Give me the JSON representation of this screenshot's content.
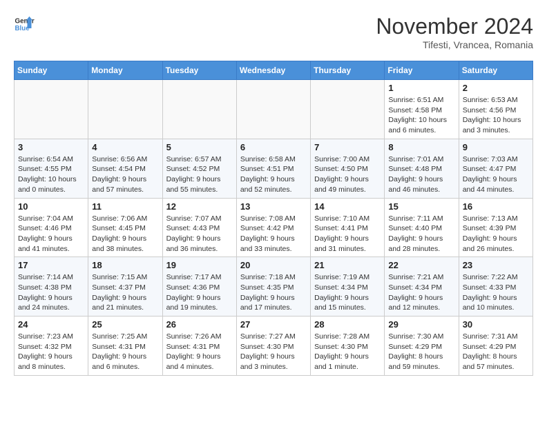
{
  "header": {
    "logo_line1": "General",
    "logo_line2": "Blue",
    "month_title": "November 2024",
    "location": "Tifesti, Vrancea, Romania"
  },
  "weekdays": [
    "Sunday",
    "Monday",
    "Tuesday",
    "Wednesday",
    "Thursday",
    "Friday",
    "Saturday"
  ],
  "weeks": [
    [
      {
        "day": "",
        "info": ""
      },
      {
        "day": "",
        "info": ""
      },
      {
        "day": "",
        "info": ""
      },
      {
        "day": "",
        "info": ""
      },
      {
        "day": "",
        "info": ""
      },
      {
        "day": "1",
        "info": "Sunrise: 6:51 AM\nSunset: 4:58 PM\nDaylight: 10 hours and 6 minutes."
      },
      {
        "day": "2",
        "info": "Sunrise: 6:53 AM\nSunset: 4:56 PM\nDaylight: 10 hours and 3 minutes."
      }
    ],
    [
      {
        "day": "3",
        "info": "Sunrise: 6:54 AM\nSunset: 4:55 PM\nDaylight: 10 hours and 0 minutes."
      },
      {
        "day": "4",
        "info": "Sunrise: 6:56 AM\nSunset: 4:54 PM\nDaylight: 9 hours and 57 minutes."
      },
      {
        "day": "5",
        "info": "Sunrise: 6:57 AM\nSunset: 4:52 PM\nDaylight: 9 hours and 55 minutes."
      },
      {
        "day": "6",
        "info": "Sunrise: 6:58 AM\nSunset: 4:51 PM\nDaylight: 9 hours and 52 minutes."
      },
      {
        "day": "7",
        "info": "Sunrise: 7:00 AM\nSunset: 4:50 PM\nDaylight: 9 hours and 49 minutes."
      },
      {
        "day": "8",
        "info": "Sunrise: 7:01 AM\nSunset: 4:48 PM\nDaylight: 9 hours and 46 minutes."
      },
      {
        "day": "9",
        "info": "Sunrise: 7:03 AM\nSunset: 4:47 PM\nDaylight: 9 hours and 44 minutes."
      }
    ],
    [
      {
        "day": "10",
        "info": "Sunrise: 7:04 AM\nSunset: 4:46 PM\nDaylight: 9 hours and 41 minutes."
      },
      {
        "day": "11",
        "info": "Sunrise: 7:06 AM\nSunset: 4:45 PM\nDaylight: 9 hours and 38 minutes."
      },
      {
        "day": "12",
        "info": "Sunrise: 7:07 AM\nSunset: 4:43 PM\nDaylight: 9 hours and 36 minutes."
      },
      {
        "day": "13",
        "info": "Sunrise: 7:08 AM\nSunset: 4:42 PM\nDaylight: 9 hours and 33 minutes."
      },
      {
        "day": "14",
        "info": "Sunrise: 7:10 AM\nSunset: 4:41 PM\nDaylight: 9 hours and 31 minutes."
      },
      {
        "day": "15",
        "info": "Sunrise: 7:11 AM\nSunset: 4:40 PM\nDaylight: 9 hours and 28 minutes."
      },
      {
        "day": "16",
        "info": "Sunrise: 7:13 AM\nSunset: 4:39 PM\nDaylight: 9 hours and 26 minutes."
      }
    ],
    [
      {
        "day": "17",
        "info": "Sunrise: 7:14 AM\nSunset: 4:38 PM\nDaylight: 9 hours and 24 minutes."
      },
      {
        "day": "18",
        "info": "Sunrise: 7:15 AM\nSunset: 4:37 PM\nDaylight: 9 hours and 21 minutes."
      },
      {
        "day": "19",
        "info": "Sunrise: 7:17 AM\nSunset: 4:36 PM\nDaylight: 9 hours and 19 minutes."
      },
      {
        "day": "20",
        "info": "Sunrise: 7:18 AM\nSunset: 4:35 PM\nDaylight: 9 hours and 17 minutes."
      },
      {
        "day": "21",
        "info": "Sunrise: 7:19 AM\nSunset: 4:34 PM\nDaylight: 9 hours and 15 minutes."
      },
      {
        "day": "22",
        "info": "Sunrise: 7:21 AM\nSunset: 4:34 PM\nDaylight: 9 hours and 12 minutes."
      },
      {
        "day": "23",
        "info": "Sunrise: 7:22 AM\nSunset: 4:33 PM\nDaylight: 9 hours and 10 minutes."
      }
    ],
    [
      {
        "day": "24",
        "info": "Sunrise: 7:23 AM\nSunset: 4:32 PM\nDaylight: 9 hours and 8 minutes."
      },
      {
        "day": "25",
        "info": "Sunrise: 7:25 AM\nSunset: 4:31 PM\nDaylight: 9 hours and 6 minutes."
      },
      {
        "day": "26",
        "info": "Sunrise: 7:26 AM\nSunset: 4:31 PM\nDaylight: 9 hours and 4 minutes."
      },
      {
        "day": "27",
        "info": "Sunrise: 7:27 AM\nSunset: 4:30 PM\nDaylight: 9 hours and 3 minutes."
      },
      {
        "day": "28",
        "info": "Sunrise: 7:28 AM\nSunset: 4:30 PM\nDaylight: 9 hours and 1 minute."
      },
      {
        "day": "29",
        "info": "Sunrise: 7:30 AM\nSunset: 4:29 PM\nDaylight: 8 hours and 59 minutes."
      },
      {
        "day": "30",
        "info": "Sunrise: 7:31 AM\nSunset: 4:29 PM\nDaylight: 8 hours and 57 minutes."
      }
    ]
  ]
}
